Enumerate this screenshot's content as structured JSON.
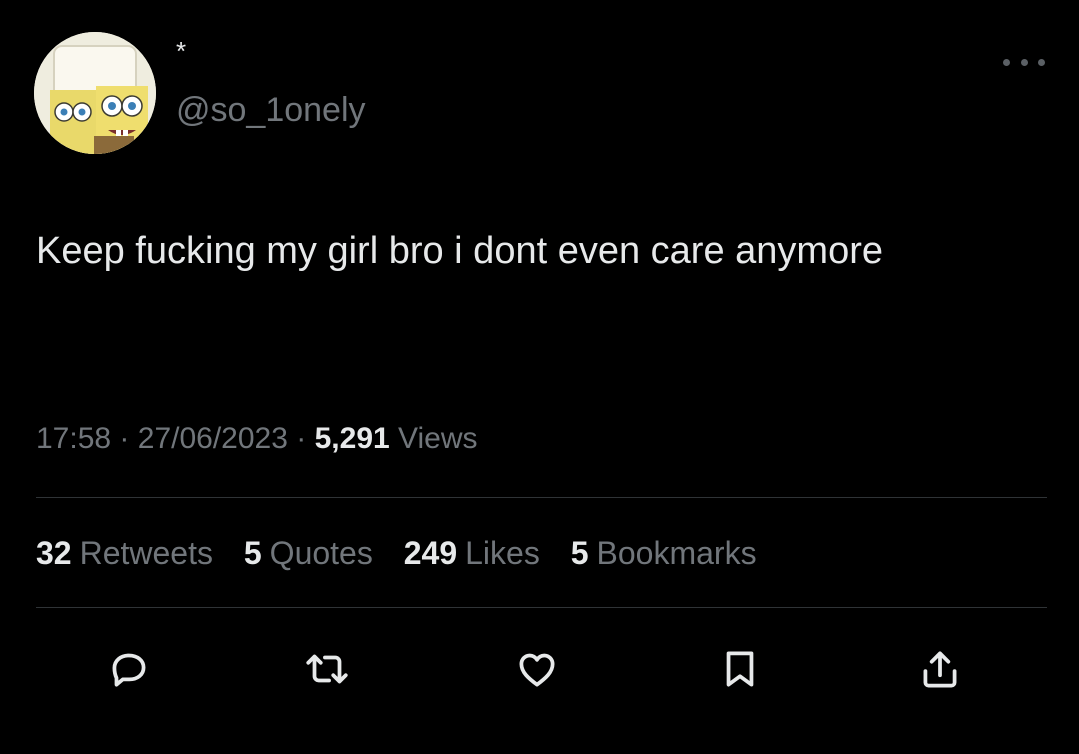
{
  "author": {
    "display_name": "*",
    "handle": "@so_1onely"
  },
  "tweet": {
    "text": "Keep fucking my girl bro i dont even care anymore"
  },
  "meta": {
    "time": "17:58",
    "separator": "·",
    "date": "27/06/2023",
    "views_count": "5,291",
    "views_label": "Views"
  },
  "stats": [
    {
      "count": "32",
      "label": "Retweets"
    },
    {
      "count": "5",
      "label": "Quotes"
    },
    {
      "count": "249",
      "label": "Likes"
    },
    {
      "count": "5",
      "label": "Bookmarks"
    }
  ],
  "actions": [
    {
      "icon": "reply-icon"
    },
    {
      "icon": "retweet-icon"
    },
    {
      "icon": "like-icon"
    },
    {
      "icon": "bookmark-icon"
    },
    {
      "icon": "share-icon"
    }
  ],
  "colors": {
    "background": "#000000",
    "primary_text": "#e7e9ea",
    "secondary_text": "#71767b",
    "divider": "#2f3336"
  }
}
